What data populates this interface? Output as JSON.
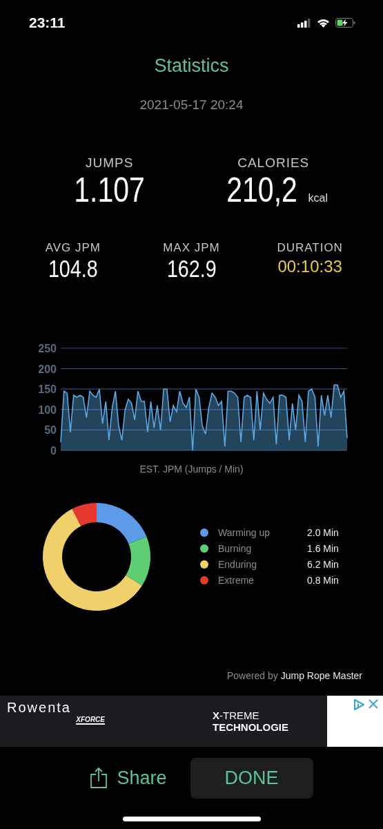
{
  "status_bar": {
    "time": "23:11"
  },
  "title": "Statistics",
  "date": "2021-05-17 20:24",
  "main_stats": [
    {
      "label": "JUMPS",
      "value": "1.107"
    },
    {
      "label": "CALORIES",
      "value": "210,2",
      "unit": "kcal"
    }
  ],
  "secondary_stats": [
    {
      "label": "AVG JPM",
      "value": "104.8",
      "kind": "plain"
    },
    {
      "label": "MAX JPM",
      "value": "162.9",
      "kind": "plain"
    },
    {
      "label": "DURATION",
      "value": "00:10:33",
      "kind": "highlight"
    }
  ],
  "jpm_chart": {
    "chart_data": {
      "type": "area",
      "grid": true,
      "xlabel": "EST. JPM (Jumps / Min)",
      "ylim": [
        0,
        250
      ],
      "yticks": [
        0,
        50,
        100,
        150,
        200,
        250
      ],
      "series": [
        {
          "color": "#5aa9e6",
          "values": [
            20,
            145,
            140,
            45,
            135,
            130,
            135,
            130,
            80,
            145,
            135,
            130,
            150,
            65,
            120,
            25,
            105,
            145,
            60,
            25,
            100,
            125,
            115,
            75,
            145,
            120,
            120,
            45,
            120,
            55,
            110,
            50,
            150,
            150,
            70,
            110,
            95,
            145,
            115,
            105,
            130,
            0,
            150,
            130,
            60,
            40,
            105,
            140,
            130,
            110,
            120,
            10,
            145,
            145,
            140,
            130,
            20,
            130,
            135,
            130,
            25,
            145,
            50,
            140,
            125,
            115,
            130,
            15,
            135,
            135,
            130,
            25,
            115,
            50,
            135,
            120,
            20,
            145,
            150,
            130,
            10,
            135,
            85,
            135,
            80,
            160,
            160,
            130,
            145,
            30
          ]
        }
      ]
    }
  },
  "zones": {
    "chart_data": {
      "type": "donut",
      "categories": [
        "Warming up",
        "Burning",
        "Enduring",
        "Extreme"
      ],
      "values": [
        18.9,
        15.1,
        58.5,
        7.5
      ]
    },
    "legend": [
      {
        "time": "2.0 Min",
        "color": "#5b9be8"
      },
      {
        "time": "1.6 Min",
        "color": "#5fcf73"
      },
      {
        "time": "6.2 Min",
        "color": "#f0d06a"
      },
      {
        "time": "0.8 Min",
        "color": "#e8392f"
      }
    ]
  },
  "powered_by": {
    "prefix": "Powered by",
    "brand": "Jump Rope Master"
  },
  "ad": {
    "brand": "Rowenta",
    "sub_brand": "XFORCE",
    "headline_bold": "X",
    "headline": "-TREME",
    "tagline": "TECHNOLOGIE"
  },
  "buttons": {
    "share": "Share",
    "done": "DONE"
  }
}
